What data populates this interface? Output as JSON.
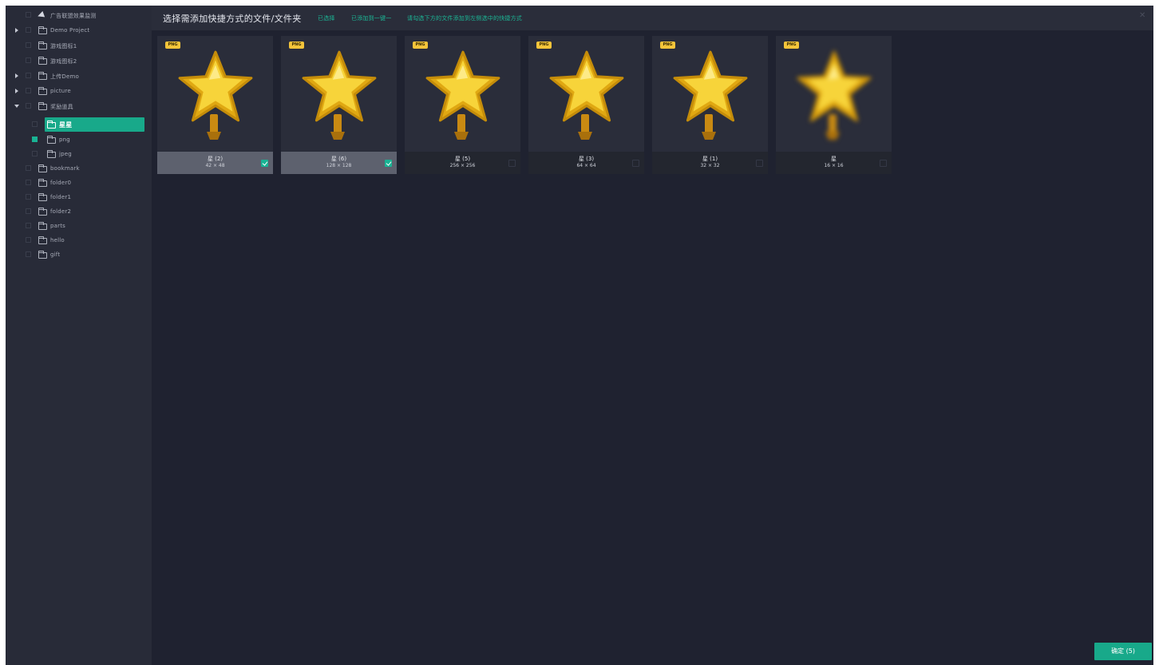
{
  "colors": {
    "accent": "#18a98a",
    "background": "#1f2230",
    "sidebar": "#282b38",
    "card": "#2a2d3a",
    "badge": "#f3c43a",
    "star": "#f5c518"
  },
  "header": {
    "title": "选择需添加快捷方式的文件/文件夹",
    "hint_1": "已选择",
    "hint_2": "已添加到一键一",
    "hint_3": "请勾选下方的文件添加到左侧选中的快捷方式",
    "close_icon": "close-icon"
  },
  "sidebar": {
    "items": [
      {
        "label": "广告联盟效果监测",
        "icon": "send-icon"
      },
      {
        "label": "Demo Project",
        "icon": "folder-icon"
      },
      {
        "label": "游戏图标1",
        "icon": "folder-icon"
      },
      {
        "label": "游戏图标2",
        "icon": "folder-icon"
      },
      {
        "label": "上传Demo",
        "icon": "folder-icon"
      },
      {
        "label": "picture",
        "icon": "folder-icon"
      },
      {
        "label": "奖励道具",
        "icon": "folder-icon"
      },
      {
        "label": "星星",
        "icon": "folder-icon"
      },
      {
        "label": "png",
        "icon": "folder-icon"
      },
      {
        "label": "jpeg",
        "icon": "folder-icon"
      },
      {
        "label": "bookmark",
        "icon": "folder-icon"
      },
      {
        "label": "folder0",
        "icon": "folder-icon"
      },
      {
        "label": "folder1",
        "icon": "folder-icon"
      },
      {
        "label": "folder2",
        "icon": "folder-icon"
      },
      {
        "label": "parts",
        "icon": "folder-icon"
      },
      {
        "label": "hello",
        "icon": "folder-icon"
      },
      {
        "label": "gift",
        "icon": "folder-icon"
      }
    ]
  },
  "cards": [
    {
      "badge": "PNG",
      "name": "星 (2)",
      "dims": "42 × 48",
      "checked": true,
      "blurred": false
    },
    {
      "badge": "PNG",
      "name": "星 (6)",
      "dims": "128 × 128",
      "checked": true,
      "blurred": false
    },
    {
      "badge": "PNG",
      "name": "星 (5)",
      "dims": "256 × 256",
      "checked": false,
      "blurred": false
    },
    {
      "badge": "PNG",
      "name": "星 (3)",
      "dims": "64 × 64",
      "checked": false,
      "blurred": false
    },
    {
      "badge": "PNG",
      "name": "星 (1)",
      "dims": "32 × 32",
      "checked": false,
      "blurred": false
    },
    {
      "badge": "PNG",
      "name": "星",
      "dims": "16 × 16",
      "checked": false,
      "blurred": true
    }
  ],
  "footer": {
    "confirm_label": "确定 (5)"
  }
}
